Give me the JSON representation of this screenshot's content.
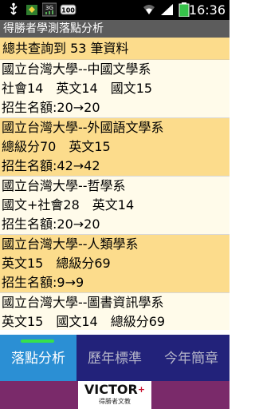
{
  "status_bar": {
    "time": "16:36",
    "icons": [
      "usb-icon",
      "app-notification-icon",
      "3g-icon",
      "battery-level-icon",
      "wifi-icon",
      "signal-icon",
      "battery-icon"
    ],
    "battery_label": "100",
    "network_label": "3G"
  },
  "header": {
    "title": "得勝者學測落點分析"
  },
  "results": {
    "summary": "總共查詢到 53 筆資料",
    "entries": [
      {
        "title": "國立台灣大學--中國文學系",
        "subjects": "社會14　英文14　國文15",
        "quota": "招生名額:20→20"
      },
      {
        "title": "國立台灣大學--外國語文學系",
        "subjects": "總級分70　英文15",
        "quota": "招生名額:42→42"
      },
      {
        "title": "國立台灣大學--哲學系",
        "subjects": "國文+社會28　英文14",
        "quota": "招生名額:20→20"
      },
      {
        "title": "國立台灣大學--人類學系",
        "subjects": "英文15　總級分69",
        "quota": "招生名額:9→9"
      },
      {
        "title": "國立台灣大學--圖書資訊學系",
        "subjects": "英文15　國文14　總級分69",
        "quota": ""
      }
    ]
  },
  "tabs": [
    {
      "label": "落點分析",
      "selected": true
    },
    {
      "label": "歷年標準",
      "selected": false
    },
    {
      "label": "今年簡章",
      "selected": false
    }
  ],
  "brand": {
    "name": "VICTOR",
    "plus": "+",
    "subtitle": "得勝者文教"
  },
  "colors": {
    "row_highlight": "#fcdc8c",
    "row_light": "#fffbea",
    "tab_selected": "#2b8fd4",
    "tab_unselected": "#22227a",
    "tab_indicator": "#36e14a",
    "brand_bar": "#7a2a6a"
  }
}
